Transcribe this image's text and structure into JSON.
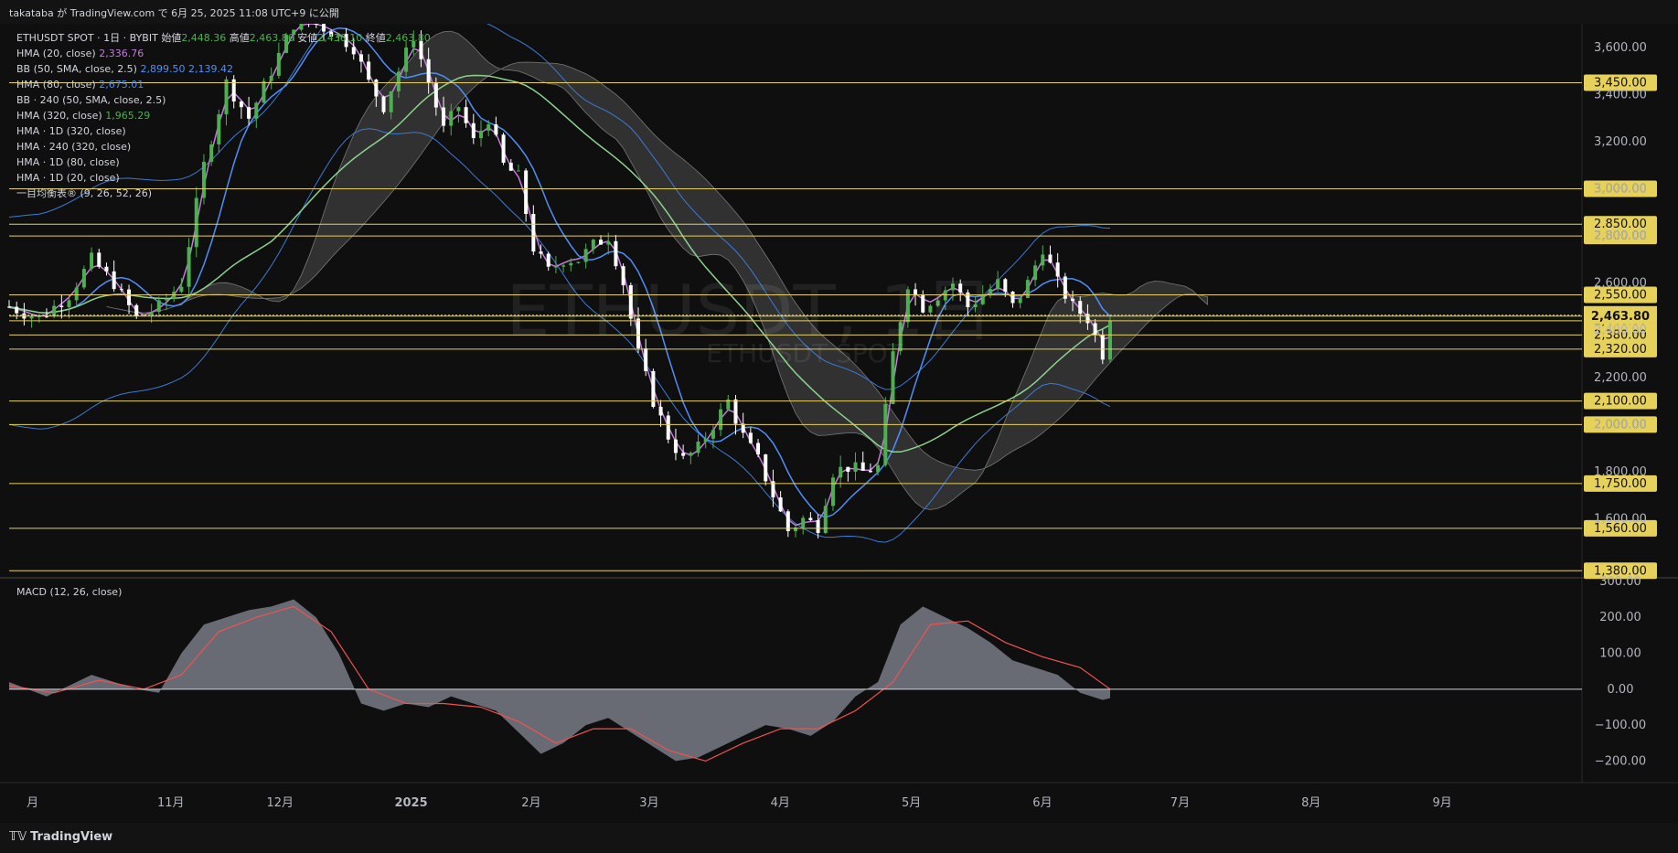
{
  "header": {
    "publish_line": "takataba が TradingView.com で 6月 25, 2025 11:08 UTC+9 に公開"
  },
  "brand": {
    "name": "TradingView",
    "logo_icon": "tradingview-logo-icon"
  },
  "watermark": {
    "main": "ETHUSDT, 1日",
    "sub": "ETHUSDT SPOT"
  },
  "legend": {
    "title": "ETHUSDT SPOT · 1日 · BYBIT",
    "open_label": "始値",
    "open": "2,448.36",
    "high_label": "高値",
    "high": "2,463.86",
    "low_label": "安値",
    "low": "2,436.10",
    "close_label": "終値",
    "close": "2,463.80",
    "hma20_label": "HMA (20, close)",
    "hma20": "2,336.76",
    "bb50_label": "BB (50, SMA, close, 2.5)",
    "bb50_upper": "2,899.50",
    "bb50_lower": "2,139.42",
    "hma80_label": "HMA (80, close)",
    "hma80": "2,675.01",
    "bb240_label": "BB · 240 (50, SMA, close, 2.5)",
    "hma320_label": "HMA (320, close)",
    "hma320": "1,965.29",
    "hma_1d_320": "HMA · 1D (320, close)",
    "hma_240_320": "HMA · 240 (320, close)",
    "hma_1d_80": "HMA · 1D (80, close)",
    "hma_1d_20": "HMA · 1D (20, close)",
    "ichimoku": "一目均衡表® (9, 26, 52, 26)"
  },
  "macd": {
    "label": "MACD (12, 26, close)"
  },
  "colors": {
    "up": "#4caf50",
    "down": "#ffffff",
    "hma20": "#c678dd",
    "hma80": "#4f8ff7",
    "hma320": "#8bd38b",
    "bb": "#3a7bd5",
    "hline": "#e6d15a",
    "cloud": "#5a5a5a",
    "macd_hist": "#787b86",
    "signal": "#ef5350",
    "last_price_bg": "#e6d15a"
  },
  "chart_data": {
    "type": "candlestick",
    "price_axis": {
      "ticks": [
        3600,
        3400,
        3200,
        3000,
        2800,
        2600,
        2400,
        2200,
        2000,
        1800,
        1600
      ],
      "tick_labels": [
        "3,600.00",
        "3,400.00",
        "3,200.00",
        "3,000.00",
        "2,800.00",
        "2,600.00",
        "2,400.00",
        "2,200.00",
        "2,000.00",
        "1,800.00",
        "1,600.00"
      ],
      "range": [
        1350,
        3700
      ],
      "last_price": 2463.8,
      "last_price_label": "2,463.80"
    },
    "horizontal_levels": [
      {
        "value": 3450,
        "label": "3,450.00"
      },
      {
        "value": 3000,
        "label": "3,000.00"
      },
      {
        "value": 2850,
        "label": "2,850.00"
      },
      {
        "value": 2800,
        "label": "2,800.00"
      },
      {
        "value": 2550,
        "label": "2,550.00"
      },
      {
        "value": 2460,
        "label": "2,460.00"
      },
      {
        "value": 2440,
        "label": "2,440.00"
      },
      {
        "value": 2380,
        "label": "2,380.00"
      },
      {
        "value": 2320,
        "label": "2,320.00"
      },
      {
        "value": 2100,
        "label": "2,100.00"
      },
      {
        "value": 2000,
        "label": "2,000.00"
      },
      {
        "value": 1750,
        "label": "1,750.00"
      },
      {
        "value": 1560,
        "label": "1,560.00"
      },
      {
        "value": 1380,
        "label": "1,380.00"
      }
    ],
    "time_axis": {
      "labels": [
        "月",
        "11月",
        "12月",
        "2025",
        "2月",
        "3月",
        "4月",
        "5月",
        "6月",
        "7月",
        "8月",
        "9月"
      ],
      "bold": [
        "2025"
      ]
    },
    "close_path": [
      [
        0,
        2500
      ],
      [
        8,
        2450
      ],
      [
        16,
        2550
      ],
      [
        22,
        2700
      ],
      [
        28,
        2600
      ],
      [
        34,
        2450
      ],
      [
        40,
        2500
      ],
      [
        46,
        2600
      ],
      [
        52,
        3100
      ],
      [
        58,
        3450
      ],
      [
        64,
        3300
      ],
      [
        70,
        3500
      ],
      [
        76,
        3700
      ],
      [
        82,
        3700
      ],
      [
        88,
        3650
      ],
      [
        92,
        3600
      ],
      [
        96,
        3450
      ],
      [
        100,
        3350
      ],
      [
        104,
        3500
      ],
      [
        108,
        3650
      ],
      [
        112,
        3450
      ],
      [
        116,
        3250
      ],
      [
        120,
        3350
      ],
      [
        124,
        3200
      ],
      [
        128,
        3300
      ],
      [
        132,
        3100
      ],
      [
        136,
        3050
      ],
      [
        140,
        2750
      ],
      [
        144,
        2650
      ],
      [
        148,
        2700
      ],
      [
        152,
        2700
      ],
      [
        156,
        2760
      ],
      [
        160,
        2800
      ],
      [
        164,
        2600
      ],
      [
        168,
        2300
      ],
      [
        172,
        2100
      ],
      [
        176,
        1950
      ],
      [
        180,
        1850
      ],
      [
        184,
        1900
      ],
      [
        188,
        2000
      ],
      [
        192,
        2100
      ],
      [
        196,
        1950
      ],
      [
        200,
        1850
      ],
      [
        204,
        1700
      ],
      [
        208,
        1550
      ],
      [
        212,
        1600
      ],
      [
        216,
        1570
      ],
      [
        220,
        1800
      ],
      [
        224,
        1820
      ],
      [
        228,
        1800
      ],
      [
        232,
        1820
      ],
      [
        236,
        2300
      ],
      [
        240,
        2600
      ],
      [
        244,
        2500
      ],
      [
        248,
        2550
      ],
      [
        252,
        2600
      ],
      [
        256,
        2500
      ],
      [
        260,
        2550
      ],
      [
        264,
        2600
      ],
      [
        268,
        2500
      ],
      [
        272,
        2600
      ],
      [
        276,
        2750
      ],
      [
        280,
        2600
      ],
      [
        284,
        2500
      ],
      [
        288,
        2450
      ],
      [
        292,
        2300
      ],
      [
        294,
        2463.8
      ]
    ],
    "macd": {
      "zero": 0,
      "ticks": [
        300,
        200,
        100,
        0,
        -100,
        -200
      ],
      "tick_labels": [
        "300.00",
        "200.00",
        "100.00",
        "0.00",
        "−100.00",
        "−200.00"
      ],
      "range": [
        -260,
        310
      ],
      "histogram_path": [
        [
          0,
          20
        ],
        [
          10,
          -20
        ],
        [
          22,
          40
        ],
        [
          34,
          0
        ],
        [
          40,
          -10
        ],
        [
          46,
          100
        ],
        [
          52,
          180
        ],
        [
          58,
          200
        ],
        [
          64,
          220
        ],
        [
          70,
          230
        ],
        [
          76,
          250
        ],
        [
          82,
          200
        ],
        [
          88,
          100
        ],
        [
          94,
          -40
        ],
        [
          100,
          -60
        ],
        [
          106,
          -40
        ],
        [
          112,
          -50
        ],
        [
          118,
          -20
        ],
        [
          124,
          -40
        ],
        [
          130,
          -60
        ],
        [
          136,
          -120
        ],
        [
          142,
          -180
        ],
        [
          148,
          -150
        ],
        [
          154,
          -100
        ],
        [
          160,
          -80
        ],
        [
          166,
          -120
        ],
        [
          172,
          -160
        ],
        [
          178,
          -200
        ],
        [
          184,
          -190
        ],
        [
          190,
          -160
        ],
        [
          196,
          -130
        ],
        [
          202,
          -100
        ],
        [
          208,
          -110
        ],
        [
          214,
          -130
        ],
        [
          220,
          -90
        ],
        [
          226,
          -20
        ],
        [
          232,
          20
        ],
        [
          238,
          180
        ],
        [
          244,
          230
        ],
        [
          250,
          200
        ],
        [
          256,
          170
        ],
        [
          262,
          130
        ],
        [
          268,
          80
        ],
        [
          274,
          60
        ],
        [
          280,
          40
        ],
        [
          286,
          -10
        ],
        [
          292,
          -30
        ],
        [
          294,
          -25
        ]
      ],
      "signal_path": [
        [
          0,
          10
        ],
        [
          12,
          -10
        ],
        [
          24,
          25
        ],
        [
          36,
          0
        ],
        [
          46,
          40
        ],
        [
          56,
          160
        ],
        [
          66,
          200
        ],
        [
          76,
          230
        ],
        [
          86,
          160
        ],
        [
          96,
          0
        ],
        [
          106,
          -40
        ],
        [
          116,
          -40
        ],
        [
          126,
          -50
        ],
        [
          136,
          -90
        ],
        [
          146,
          -150
        ],
        [
          156,
          -110
        ],
        [
          166,
          -110
        ],
        [
          176,
          -170
        ],
        [
          186,
          -200
        ],
        [
          196,
          -150
        ],
        [
          206,
          -110
        ],
        [
          216,
          -110
        ],
        [
          226,
          -60
        ],
        [
          236,
          20
        ],
        [
          246,
          180
        ],
        [
          256,
          190
        ],
        [
          266,
          130
        ],
        [
          276,
          90
        ],
        [
          286,
          60
        ],
        [
          294,
          0
        ]
      ]
    }
  }
}
